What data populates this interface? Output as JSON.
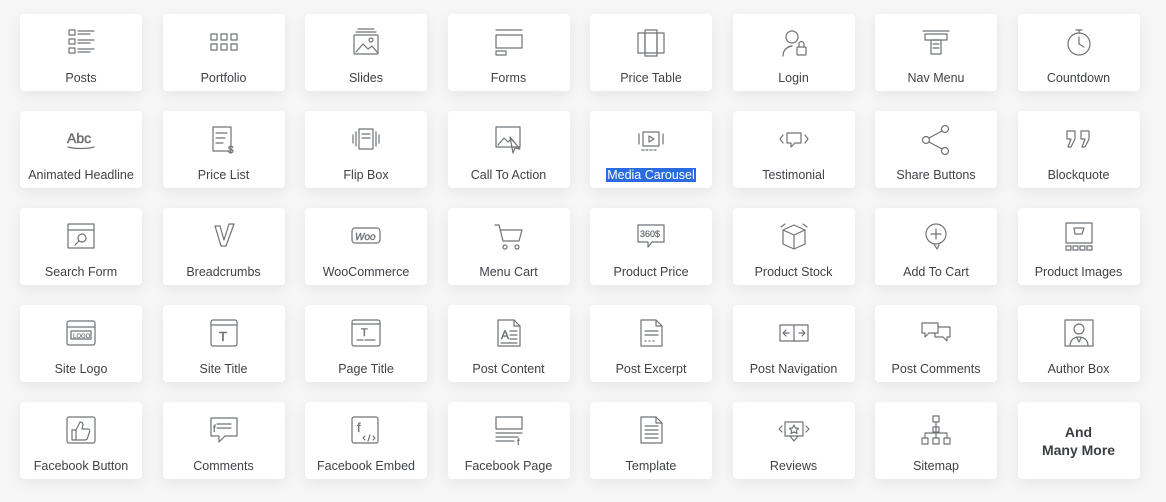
{
  "widgets": [
    {
      "label": "Posts",
      "icon": "posts-icon"
    },
    {
      "label": "Portfolio",
      "icon": "portfolio-icon"
    },
    {
      "label": "Slides",
      "icon": "slides-icon"
    },
    {
      "label": "Forms",
      "icon": "forms-icon"
    },
    {
      "label": "Price Table",
      "icon": "price-table-icon"
    },
    {
      "label": "Login",
      "icon": "login-icon"
    },
    {
      "label": "Nav Menu",
      "icon": "nav-menu-icon"
    },
    {
      "label": "Countdown",
      "icon": "countdown-icon"
    },
    {
      "label": "Animated Headline",
      "icon": "animated-headline-icon"
    },
    {
      "label": "Price List",
      "icon": "price-list-icon"
    },
    {
      "label": "Flip Box",
      "icon": "flip-box-icon"
    },
    {
      "label": "Call To Action",
      "icon": "call-to-action-icon"
    },
    {
      "label": "Media Carousel",
      "icon": "media-carousel-icon",
      "selected": true
    },
    {
      "label": "Testimonial",
      "icon": "testimonial-icon"
    },
    {
      "label": "Share Buttons",
      "icon": "share-buttons-icon"
    },
    {
      "label": "Blockquote",
      "icon": "blockquote-icon"
    },
    {
      "label": "Search Form",
      "icon": "search-form-icon"
    },
    {
      "label": "Breadcrumbs",
      "icon": "breadcrumbs-icon"
    },
    {
      "label": "WooCommerce",
      "icon": "woocommerce-icon"
    },
    {
      "label": "Menu Cart",
      "icon": "menu-cart-icon"
    },
    {
      "label": "Product Price",
      "icon": "product-price-icon"
    },
    {
      "label": "Product Stock",
      "icon": "product-stock-icon"
    },
    {
      "label": "Add To Cart",
      "icon": "add-to-cart-icon"
    },
    {
      "label": "Product Images",
      "icon": "product-images-icon"
    },
    {
      "label": "Site Logo",
      "icon": "site-logo-icon"
    },
    {
      "label": "Site Title",
      "icon": "site-title-icon"
    },
    {
      "label": "Page Title",
      "icon": "page-title-icon"
    },
    {
      "label": "Post Content",
      "icon": "post-content-icon"
    },
    {
      "label": "Post Excerpt",
      "icon": "post-excerpt-icon"
    },
    {
      "label": "Post Navigation",
      "icon": "post-navigation-icon"
    },
    {
      "label": "Post Comments",
      "icon": "post-comments-icon"
    },
    {
      "label": "Author Box",
      "icon": "author-box-icon"
    },
    {
      "label": "Facebook Button",
      "icon": "facebook-button-icon"
    },
    {
      "label": "Comments",
      "icon": "comments-icon"
    },
    {
      "label": "Facebook Embed",
      "icon": "facebook-embed-icon"
    },
    {
      "label": "Facebook Page",
      "icon": "facebook-page-icon"
    },
    {
      "label": "Template",
      "icon": "template-icon"
    },
    {
      "label": "Reviews",
      "icon": "reviews-icon"
    },
    {
      "label": "Sitemap",
      "icon": "sitemap-icon"
    }
  ],
  "more": {
    "line1": "And",
    "line2": "Many More"
  },
  "icon_texts": {
    "site_logo": "LOGO",
    "price": "360$",
    "woo": "Woo",
    "abc": "Abc",
    "site_title": "T",
    "dollar": "$"
  },
  "colors": {
    "icon_stroke": "#6f7377",
    "label": "#3f4247",
    "selection": "#2a6be0",
    "background": "#f6f6f7"
  }
}
